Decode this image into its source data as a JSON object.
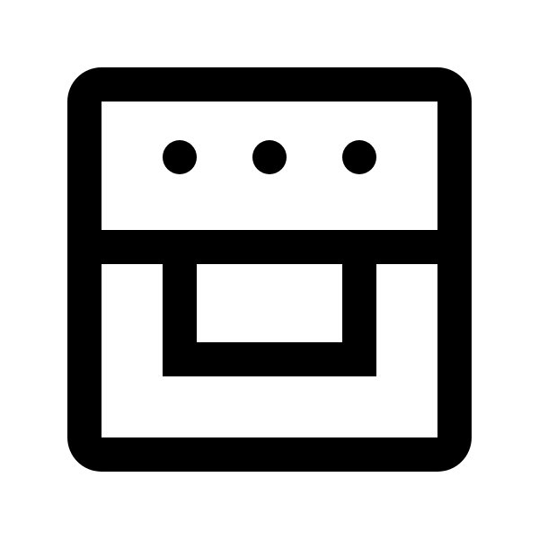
{
  "icon": {
    "name": "oven-icon",
    "stroke_color": "#000000",
    "background_color": "#ffffff"
  }
}
